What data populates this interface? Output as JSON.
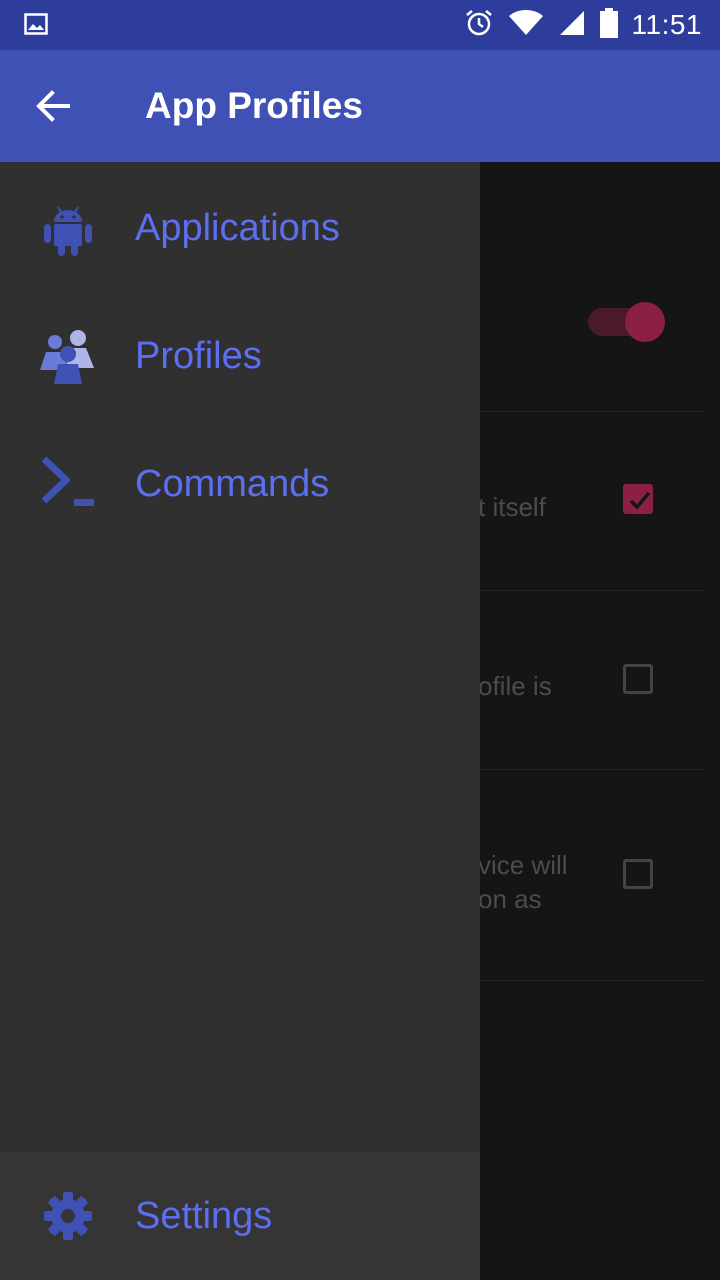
{
  "status_bar": {
    "time": "11:51"
  },
  "app_bar": {
    "title": "App Profiles"
  },
  "drawer": {
    "items": [
      {
        "label": "Applications",
        "icon": "android-icon"
      },
      {
        "label": "Profiles",
        "icon": "people-icon"
      },
      {
        "label": "Commands",
        "icon": "terminal-icon"
      }
    ],
    "footer": {
      "label": "Settings",
      "icon": "gear-icon"
    }
  },
  "background": {
    "switch_on": true,
    "rows": [
      {
        "text_lines": [
          "t itself"
        ],
        "checked": true
      },
      {
        "text_lines": [
          "ofile is"
        ],
        "checked": false
      },
      {
        "text_lines": [
          "vice will",
          "on as"
        ],
        "checked": false
      }
    ]
  },
  "colors": {
    "status_bar": "#2e3d9c",
    "app_bar": "#3f51b5",
    "drawer_bg": "#303030",
    "nav_accent": "#5c6ff0",
    "accent_pink": "#8c1f46"
  }
}
